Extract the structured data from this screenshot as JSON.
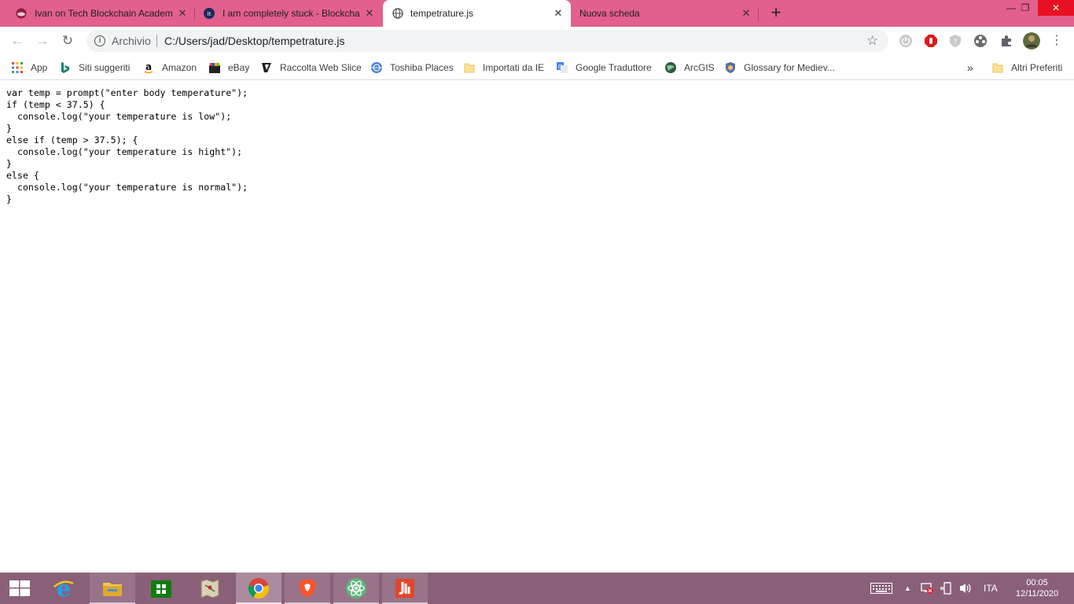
{
  "browser": {
    "tabs": [
      {
        "title": "Ivan on Tech Blockchain Academ",
        "close": "✕",
        "active": false
      },
      {
        "title": "I am completely stuck - Blockcha",
        "close": "✕",
        "active": false
      },
      {
        "title": "tempetrature.js",
        "close": "✕",
        "active": true
      },
      {
        "title": "Nuova scheda",
        "close": "✕",
        "active": false
      }
    ],
    "new_tab": "+",
    "window_controls": {
      "minimize": "—",
      "restore": "❐",
      "close": "✕"
    },
    "nav": {
      "back": "←",
      "forward": "→",
      "reload": "↻"
    },
    "omnibox": {
      "info": "i",
      "scheme": "Archivio",
      "url": "C:/Users/jad/Desktop/tempetrature.js",
      "star": "☆"
    },
    "bookmarks": [
      {
        "label": "App",
        "icon": "apps-grid-icon"
      },
      {
        "label": "Siti suggeriti",
        "icon": "bing-icon"
      },
      {
        "label": "Amazon",
        "icon": "amazon-icon"
      },
      {
        "label": "eBay",
        "icon": "ebay-icon"
      },
      {
        "label": "Raccolta Web Slice",
        "icon": "web-slice-icon"
      },
      {
        "label": "Toshiba Places",
        "icon": "toshiba-icon"
      },
      {
        "label": "Importati da IE",
        "icon": "folder-icon"
      },
      {
        "label": "Google Traduttore",
        "icon": "google-translate-icon"
      },
      {
        "label": "ArcGIS",
        "icon": "globe-icon"
      },
      {
        "label": "Glossary for Mediev...",
        "icon": "shield-crest-icon"
      }
    ],
    "bookmarks_overflow": "»",
    "other_bookmarks": "Altri Preferiti"
  },
  "page": {
    "code": "var temp = prompt(\"enter body temperature\");\nif (temp < 37.5) {\n  console.log(\"your temperature is low\");\n}\nelse if (temp > 37.5); {\n  console.log(\"your temperature is hight\");\n}\nelse {\n  console.log(\"your temperature is normal\");\n}"
  },
  "taskbar": {
    "apps": [
      "windows-start-icon",
      "internet-explorer-icon",
      "file-explorer-icon",
      "store-icon",
      "maps-app-icon",
      "chrome-icon",
      "brave-icon",
      "atom-icon",
      "app-red-icon"
    ],
    "language": "ITA",
    "time": "00:05",
    "date": "12/11/2020"
  },
  "colors": {
    "tabstrip": "#e25f8e",
    "taskbar": "#8a6079"
  }
}
